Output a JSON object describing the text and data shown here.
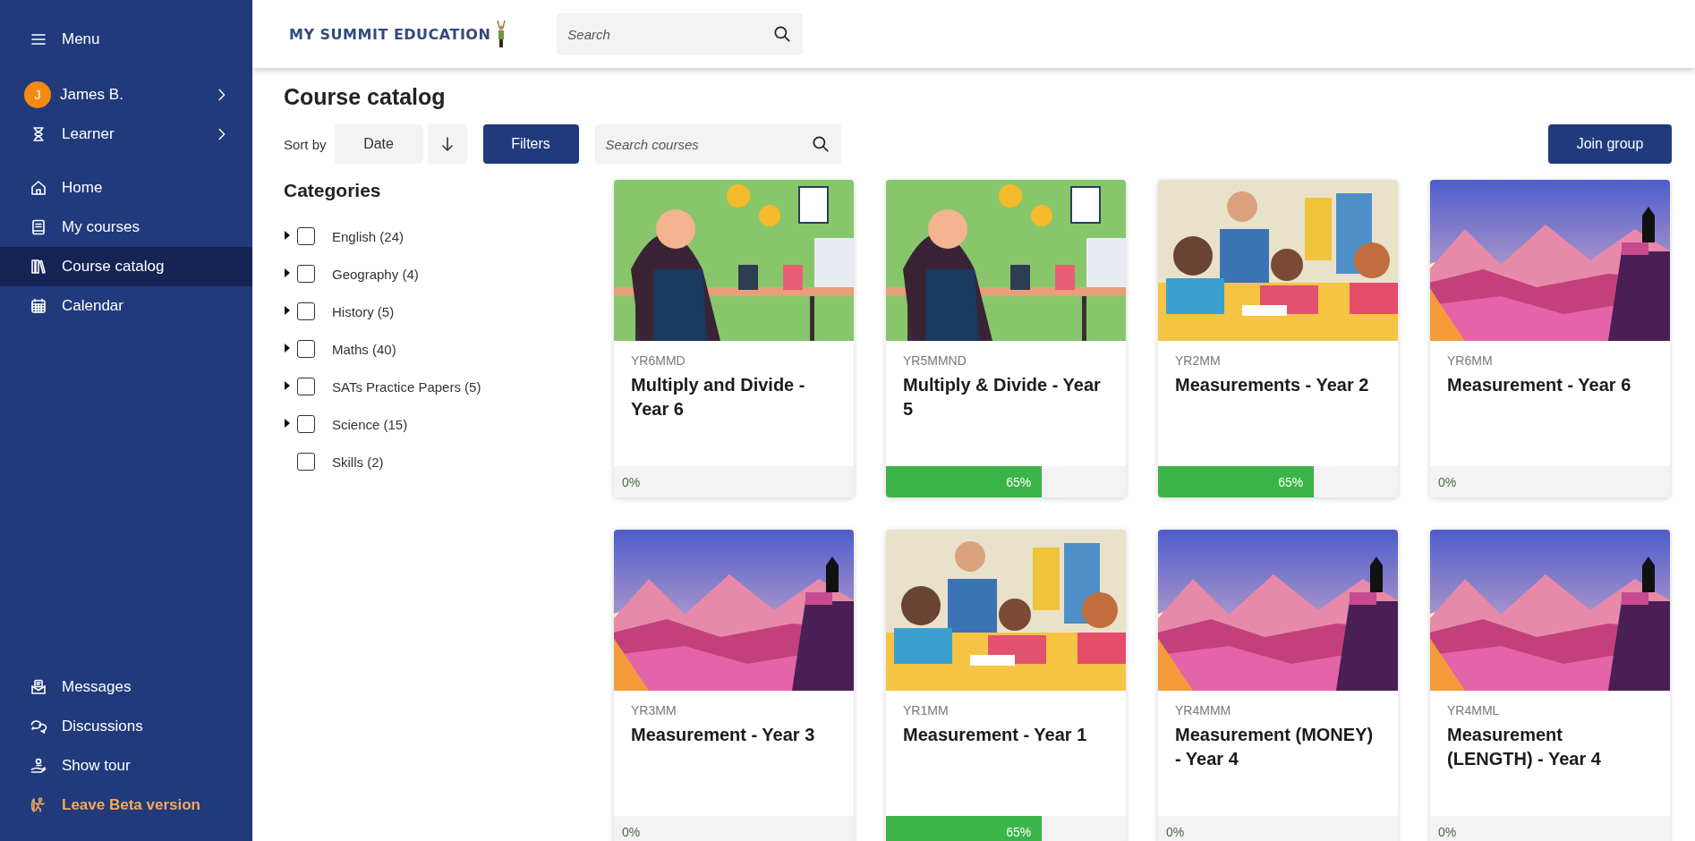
{
  "sidebar": {
    "menu_label": "Menu",
    "user": {
      "initial": "J",
      "name": "James B."
    },
    "role": "Learner",
    "nav": [
      {
        "label": "Home",
        "selected": false
      },
      {
        "label": "My courses",
        "selected": false
      },
      {
        "label": "Course catalog",
        "selected": true
      },
      {
        "label": "Calendar",
        "selected": false
      }
    ],
    "bottom": [
      {
        "label": "Messages",
        "kind": "normal"
      },
      {
        "label": "Discussions",
        "kind": "normal"
      },
      {
        "label": "Show tour",
        "kind": "normal"
      },
      {
        "label": "Leave Beta version",
        "kind": "highlight"
      }
    ]
  },
  "header": {
    "logo": "MY SUMMIT EDUCATION",
    "search": {
      "placeholder": "Search"
    }
  },
  "page_title": "Course catalog",
  "toolbar": {
    "sort_label": "Sort by",
    "sort_value": "Date",
    "filters": "Filters",
    "search": {
      "placeholder": "Search courses"
    },
    "join": "Join group"
  },
  "categories": {
    "title": "Categories",
    "items": [
      {
        "label": "English (24)",
        "expandable": true,
        "checked": false
      },
      {
        "label": "Geography (4)",
        "expandable": true,
        "checked": false
      },
      {
        "label": "History (5)",
        "expandable": true,
        "checked": false
      },
      {
        "label": "Maths (40)",
        "expandable": true,
        "checked": false
      },
      {
        "label": "SATs Practice Papers (5)",
        "expandable": true,
        "checked": false
      },
      {
        "label": "Science (15)",
        "expandable": true,
        "checked": false
      },
      {
        "label": "Skills (2)",
        "expandable": false,
        "checked": false
      }
    ]
  },
  "courses": [
    {
      "code": "YR6MMD",
      "title": "Multiply and Divide - Year 6",
      "progress": "0%",
      "level": 0
    },
    {
      "code": "YR5MMND",
      "title": "Multiply & Divide - Year 5",
      "progress": "65%",
      "level": 0.65
    },
    {
      "code": "YR2MM",
      "title": "Measurements - Year 2",
      "progress": "65%",
      "level": 0.65
    },
    {
      "code": "YR6MM",
      "title": "Measurement - Year 6",
      "progress": "0%",
      "level": 0
    },
    {
      "code": "YR3MM",
      "title": "Measurement - Year 3",
      "progress": "0%",
      "level": 0
    },
    {
      "code": "YR1MM",
      "title": "Measurement - Year 1",
      "progress": "65%",
      "level": 0.65
    },
    {
      "code": "YR4MMM",
      "title": "Measurement (MONEY) - Year 4",
      "progress": "0%",
      "level": 0
    },
    {
      "code": "YR4MML",
      "title": "Measurement (LENGTH) - Year 4",
      "progress": "0%",
      "level": 0
    }
  ]
}
